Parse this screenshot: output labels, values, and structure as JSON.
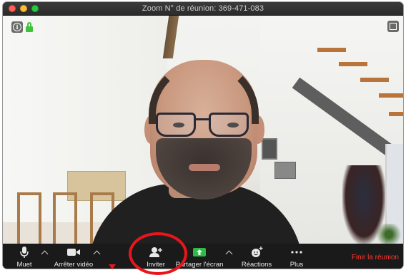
{
  "window": {
    "title": "Zoom N° de réunion: 369-471-083"
  },
  "video": {
    "participant": "",
    "info_icon": "info-icon",
    "lock_icon": "lock-icon",
    "fullscreen_icon": "fullscreen-icon",
    "lock_color": "#3ec33a"
  },
  "toolbar": {
    "mute_label": "Muet",
    "stop_video_label": "Arrêter vidéo",
    "invite_label": "Inviter",
    "share_screen_label": "Partager l'écran",
    "reactions_label": "Réactions",
    "more_label": "Plus",
    "end_meeting_label": "Finir la réunion",
    "share_color": "#2dbb45",
    "end_color": "#ff3b30"
  },
  "annotation": {
    "color": "#e8161b",
    "highlighted": "Inviter"
  }
}
